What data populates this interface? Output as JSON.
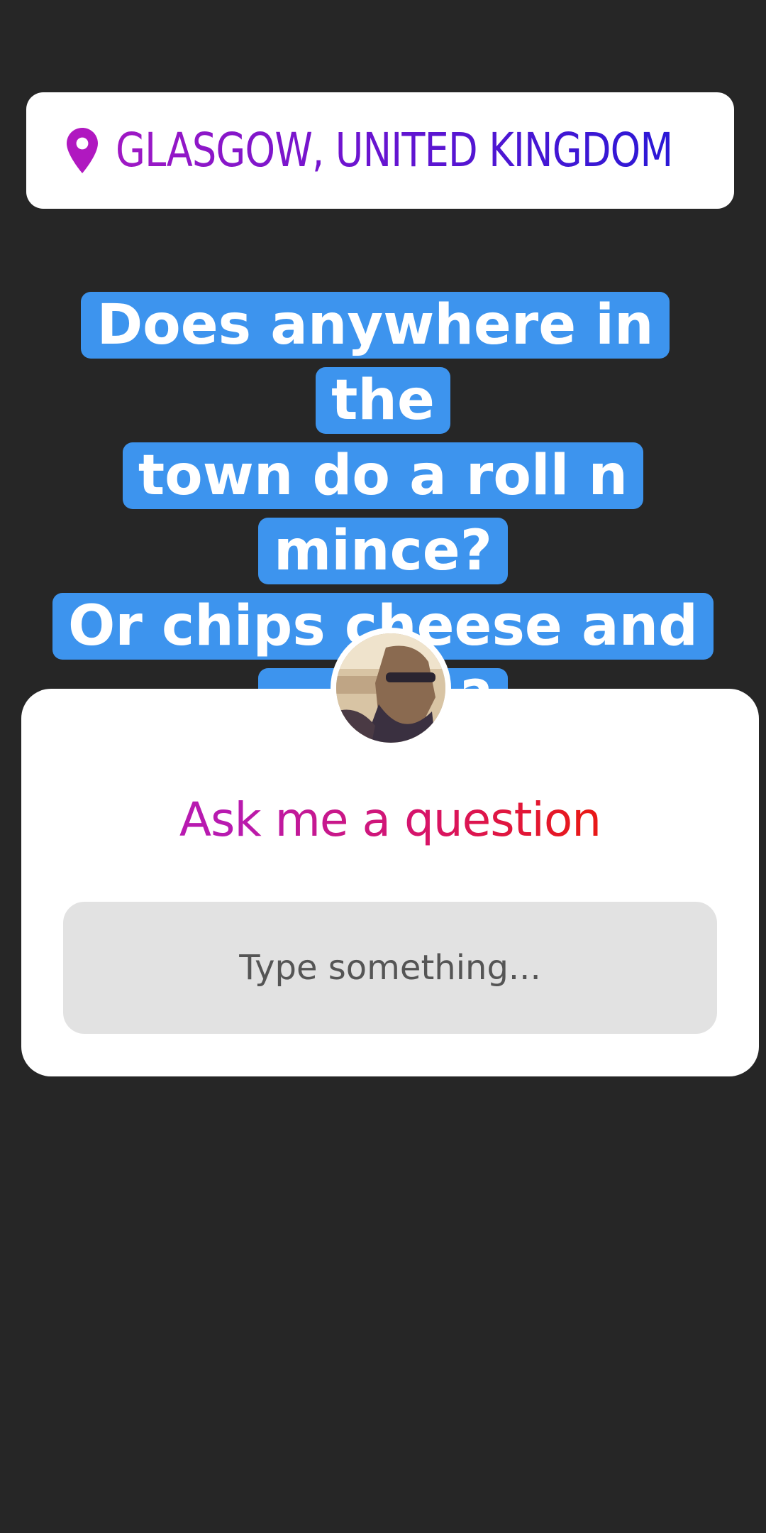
{
  "location_sticker": {
    "icon": "map-pin-icon",
    "text": "GLASGOW, UNITED KINGDOM",
    "gradient": [
      "#a018c4",
      "#2a18d6"
    ]
  },
  "question_text": {
    "lines": [
      "Does anywhere in the",
      "town do a roll n mince?",
      "Or chips cheese and",
      "mince?"
    ],
    "highlight_color": "#3d94ee"
  },
  "question_sticker": {
    "avatar": "profile-avatar",
    "title": "Ask me a question",
    "title_gradient": [
      "#b81ab0",
      "#e81818"
    ],
    "input_placeholder": "Type something..."
  },
  "background_color": "#262626"
}
